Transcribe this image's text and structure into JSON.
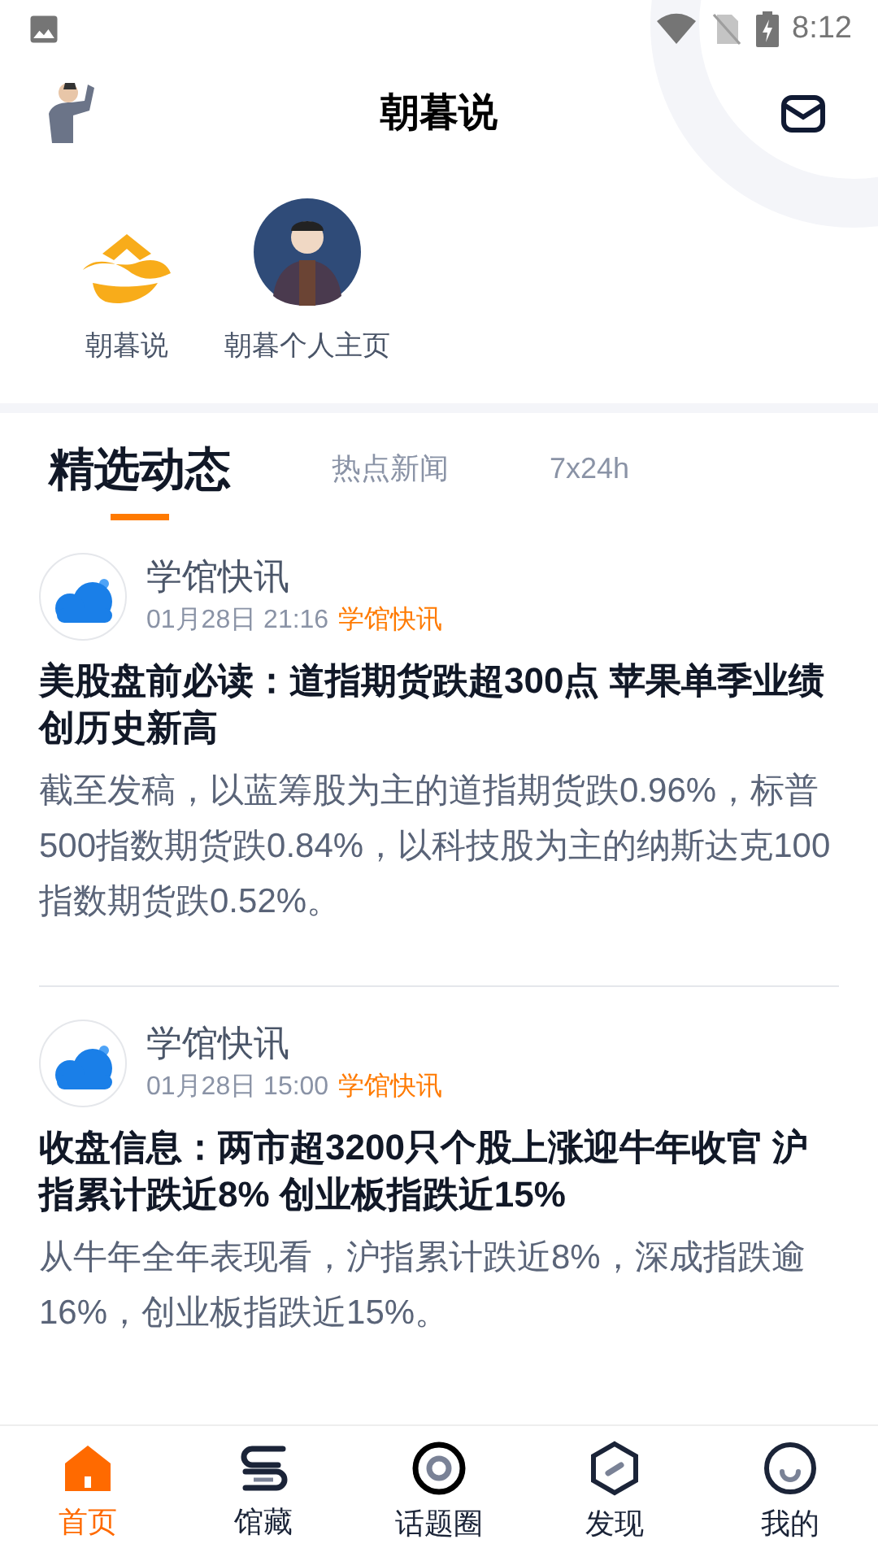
{
  "status_bar": {
    "time": "8:12"
  },
  "header": {
    "title": "朝暮说"
  },
  "shortcuts": [
    {
      "label": "朝暮说",
      "kind": "logo"
    },
    {
      "label": "朝暮个人主页",
      "kind": "avatar"
    }
  ],
  "tabs": [
    {
      "label": "精选动态",
      "selected": true
    },
    {
      "label": "热点新闻",
      "selected": false
    },
    {
      "label": "7x24h",
      "selected": false
    }
  ],
  "posts": [
    {
      "author": "学馆快讯",
      "time": "01月28日 21:16",
      "tag": "学馆快讯",
      "title": "美股盘前必读：道指期货跌超300点 苹果单季业绩创历史新高",
      "body": "截至发稿，以蓝筹股为主的道指期货跌0.96%，标普500指数期货跌0.84%，以科技股为主的纳斯达克100指数期货跌0.52%。"
    },
    {
      "author": "学馆快讯",
      "time": "01月28日 15:00",
      "tag": "学馆快讯",
      "title": "收盘信息：两市超3200只个股上涨迎牛年收官 沪指累计跌近8% 创业板指跌近15%",
      "body": "从牛年全年表现看，沪指累计跌近8%，深成指跌逾16%，创业板指跌近15%。"
    }
  ],
  "bottom_nav": [
    {
      "label": "首页",
      "kind": "home",
      "selected": true
    },
    {
      "label": "馆藏",
      "kind": "books",
      "selected": false
    },
    {
      "label": "话题圈",
      "kind": "ring",
      "selected": false
    },
    {
      "label": "发现",
      "kind": "hexagon",
      "selected": false
    },
    {
      "label": "我的",
      "kind": "smile",
      "selected": false
    }
  ]
}
